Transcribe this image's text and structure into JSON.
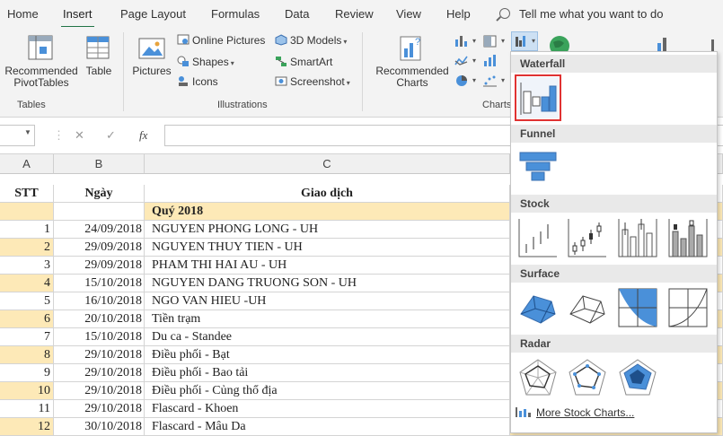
{
  "menu": {
    "tabs": [
      "Home",
      "Insert",
      "Page Layout",
      "Formulas",
      "Data",
      "Review",
      "View",
      "Help"
    ],
    "active_tab": "Insert",
    "tell_me_placeholder": "Tell me what you want to do"
  },
  "ribbon": {
    "tables": {
      "group_label": "Tables",
      "recommended_pivot_line1": "Recommended",
      "recommended_pivot_line2": "PivotTables",
      "table_label": "Table"
    },
    "illustrations": {
      "group_label": "Illustrations",
      "pictures_label": "Pictures",
      "online_pictures": "Online Pictures",
      "shapes": "Shapes",
      "icons": "Icons",
      "models_3d": "3D Models",
      "smartart": "SmartArt",
      "screenshot": "Screenshot"
    },
    "charts": {
      "group_label": "Charts",
      "recommended_line1": "Recommended",
      "recommended_line2": "Charts"
    }
  },
  "namebox": {
    "value": ""
  },
  "formula_bar": {
    "fx_label": "fx",
    "value": ""
  },
  "columns": [
    "A",
    "B",
    "C"
  ],
  "sheet": {
    "header": {
      "stt": "STT",
      "ngay": "Ngày",
      "giao_dich": "Giao dịch"
    },
    "quarter_label": "Quý 2018",
    "rows": [
      {
        "stt": "1",
        "date": "24/09/2018",
        "desc": "NGUYEN PHONG LONG - UH",
        "highlight": false
      },
      {
        "stt": "2",
        "date": "29/09/2018",
        "desc": "NGUYEN THUY TIEN - UH",
        "highlight": true
      },
      {
        "stt": "3",
        "date": "29/09/2018",
        "desc": "PHAM THI HAI AU - UH",
        "highlight": false
      },
      {
        "stt": "4",
        "date": "15/10/2018",
        "desc": "NGUYEN DANG TRUONG SON - UH",
        "highlight": true
      },
      {
        "stt": "5",
        "date": "16/10/2018",
        "desc": "NGO VAN HIEU -UH",
        "highlight": false
      },
      {
        "stt": "6",
        "date": "20/10/2018",
        "desc": "Tiền trạm",
        "highlight": true
      },
      {
        "stt": "7",
        "date": "15/10/2018",
        "desc": "Du ca - Standee",
        "highlight": false
      },
      {
        "stt": "8",
        "date": "29/10/2018",
        "desc": "Điều phối - Bạt",
        "highlight": true
      },
      {
        "stt": "9",
        "date": "29/10/2018",
        "desc": "Điều phối - Bao tải",
        "highlight": false
      },
      {
        "stt": "10",
        "date": "29/10/2018",
        "desc": "Điều phối - Củng thổ địa",
        "highlight": true
      },
      {
        "stt": "11",
        "date": "29/10/2018",
        "desc": "Flascard - Khoen",
        "highlight": false
      },
      {
        "stt": "12",
        "date": "30/10/2018",
        "desc": "Flascard - Mâu Da",
        "highlight": true
      }
    ]
  },
  "dropdown": {
    "sections": [
      "Waterfall",
      "Funnel",
      "Stock",
      "Surface",
      "Radar"
    ],
    "more_link": "More Stock Charts..."
  },
  "colors": {
    "accent": "#217346",
    "row_highlight": "#fde9b7",
    "chart_blue": "#4a90d9",
    "selection": "#e03232"
  }
}
